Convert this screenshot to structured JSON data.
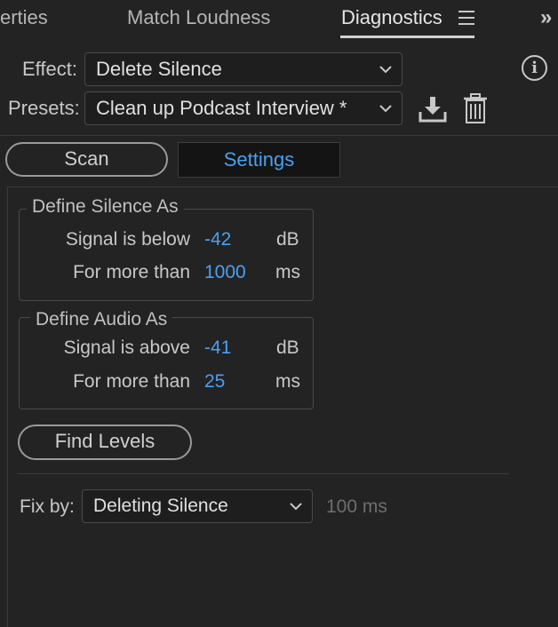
{
  "tabs": {
    "properties_partial": "erties",
    "match_loudness": "Match Loudness",
    "diagnostics": "Diagnostics",
    "overflow_glyph": "»"
  },
  "effect": {
    "label": "Effect:",
    "value": "Delete Silence"
  },
  "presets": {
    "label": "Presets:",
    "value": "Clean up Podcast Interview *"
  },
  "icons": {
    "info": "info-icon",
    "info_glyph": "i",
    "save_preset": "download-icon",
    "delete_preset": "trash-icon",
    "panel_menu": "hamburger-icon",
    "overflow": "chevron-double-right-icon"
  },
  "mode_buttons": {
    "scan": "Scan",
    "settings": "Settings"
  },
  "define_silence": {
    "title": "Define Silence As",
    "signal_label": "Signal is below",
    "signal_value": "-42",
    "signal_unit": "dB",
    "duration_label": "For more than",
    "duration_value": "1000",
    "duration_unit": "ms"
  },
  "define_audio": {
    "title": "Define Audio As",
    "signal_label": "Signal is above",
    "signal_value": "-41",
    "signal_unit": "dB",
    "duration_label": "For more than",
    "duration_value": "25",
    "duration_unit": "ms"
  },
  "find_levels": "Find Levels",
  "fix_by": {
    "label": "Fix by:",
    "value": "Deleting Silence",
    "disabled_value": "100 ms"
  },
  "colors": {
    "accent_blue": "#4aa0f0",
    "background": "#232323",
    "text": "#c8c8c8",
    "disabled_text": "#6e6e6e"
  }
}
